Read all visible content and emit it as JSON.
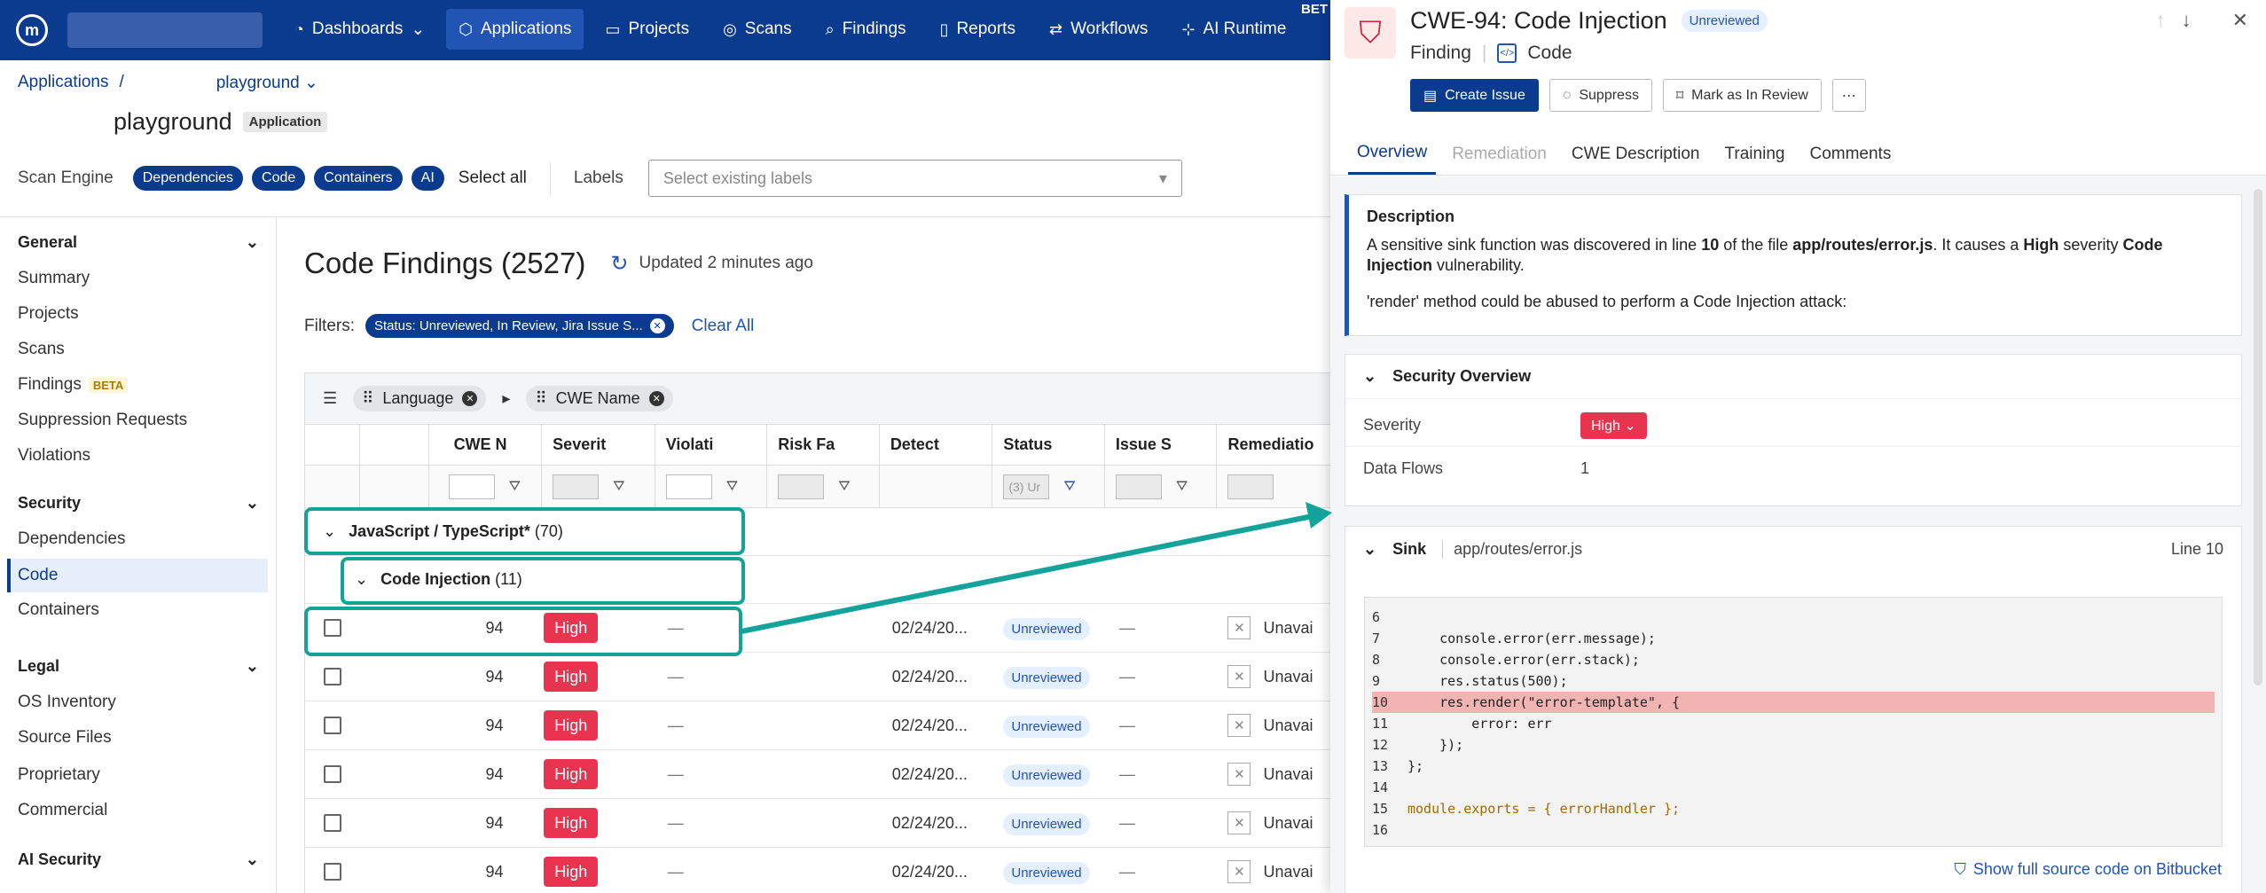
{
  "nav": {
    "items": [
      {
        "label": "Dashboards",
        "icon": "dashboard-icon"
      },
      {
        "label": "Applications",
        "icon": "applications-icon"
      },
      {
        "label": "Projects",
        "icon": "folder-icon"
      },
      {
        "label": "Scans",
        "icon": "scan-icon"
      },
      {
        "label": "Findings",
        "icon": "search-icon"
      },
      {
        "label": "Reports",
        "icon": "report-icon"
      },
      {
        "label": "Workflows",
        "icon": "workflow-icon"
      },
      {
        "label": "AI Runtime",
        "icon": "ai-icon"
      }
    ],
    "beta": "BET"
  },
  "breadcrumb": {
    "root": "Applications",
    "sep": "/",
    "app": "playground"
  },
  "app": {
    "title": "playground",
    "badge": "Application"
  },
  "engine": {
    "label": "Scan Engine",
    "pills": [
      "Dependencies",
      "Code",
      "Containers",
      "AI"
    ],
    "select_all": "Select all",
    "labels_label": "Labels",
    "labels_placeholder": "Select existing labels"
  },
  "sidebar": {
    "general": "General",
    "general_items": [
      "Summary",
      "Projects",
      "Scans",
      "Findings",
      "Suppression Requests",
      "Violations"
    ],
    "findings_beta": "BETA",
    "security": "Security",
    "security_items": [
      "Dependencies",
      "Code",
      "Containers"
    ],
    "legal": "Legal",
    "legal_items": [
      "OS Inventory",
      "Source Files",
      "Proprietary",
      "Commercial"
    ],
    "ai_security": "AI Security"
  },
  "main": {
    "title": "Code Findings (2527)",
    "updated": "Updated 2 minutes ago",
    "filters_label": "Filters:",
    "filter_chip": "Status: Unreviewed, In Review, Jira Issue S...",
    "clear_all": "Clear All",
    "group_chips": [
      "Language",
      "CWE Name"
    ],
    "columns": [
      "CWE N",
      "Severit",
      "Violati",
      "Risk Fa",
      "Detect",
      "Status",
      "Issue S",
      "Remediatio"
    ],
    "status_filter_placeholder": "(3) Ur",
    "group_lang": "JavaScript / TypeScript*",
    "group_lang_count": "(70)",
    "group_cwe": "Code Injection",
    "group_cwe_count": "(11)",
    "rows": [
      {
        "cwe": "94",
        "severity": "High",
        "violation": "—",
        "detected": "02/24/20...",
        "status": "Unreviewed",
        "issue": "—",
        "remediation": "Unavai"
      },
      {
        "cwe": "94",
        "severity": "High",
        "violation": "—",
        "detected": "02/24/20...",
        "status": "Unreviewed",
        "issue": "—",
        "remediation": "Unavai"
      },
      {
        "cwe": "94",
        "severity": "High",
        "violation": "—",
        "detected": "02/24/20...",
        "status": "Unreviewed",
        "issue": "—",
        "remediation": "Unavai"
      },
      {
        "cwe": "94",
        "severity": "High",
        "violation": "—",
        "detected": "02/24/20...",
        "status": "Unreviewed",
        "issue": "—",
        "remediation": "Unavai"
      },
      {
        "cwe": "94",
        "severity": "High",
        "violation": "—",
        "detected": "02/24/20...",
        "status": "Unreviewed",
        "issue": "—",
        "remediation": "Unavai"
      },
      {
        "cwe": "94",
        "severity": "High",
        "violation": "—",
        "detected": "02/24/20...",
        "status": "Unreviewed",
        "issue": "—",
        "remediation": "Unavai"
      }
    ]
  },
  "panel": {
    "title": "CWE-94: Code Injection",
    "status": "Unreviewed",
    "sub1": "Finding",
    "sub2": "Code",
    "actions": {
      "create": "Create Issue",
      "suppress": "Suppress",
      "review": "Mark as In Review",
      "more": "⋯"
    },
    "tabs": [
      "Overview",
      "Remediation",
      "CWE Description",
      "Training",
      "Comments"
    ],
    "desc": {
      "heading": "Description",
      "p1_a": "A sensitive sink function was discovered in line ",
      "p1_line": "10",
      "p1_b": " of the file ",
      "p1_file": "app/routes/error.js",
      "p1_c": ". It causes a ",
      "p1_sev": "High",
      "p1_d": " severity ",
      "p1_vuln1": "Code",
      "p1_vuln2": "Injection",
      "p1_e": " vulnerability.",
      "p2": "'render' method could be abused to perform a Code Injection attack:"
    },
    "security_overview": {
      "heading": "Security Overview",
      "severity_label": "Severity",
      "severity_value": "High",
      "flows_label": "Data Flows",
      "flows_value": "1"
    },
    "sink": {
      "label": "Sink",
      "file": "app/routes/error.js",
      "line": "Line 10"
    },
    "code": [
      {
        "n": "6",
        "t": ""
      },
      {
        "n": "7",
        "t": "    console.error(err.message);"
      },
      {
        "n": "8",
        "t": "    console.error(err.stack);"
      },
      {
        "n": "9",
        "t": "    res.status(500);"
      },
      {
        "n": "10",
        "t": "    res.render(\"error-template\", {"
      },
      {
        "n": "11",
        "t": "        error: err"
      },
      {
        "n": "12",
        "t": "    });"
      },
      {
        "n": "13",
        "t": "};"
      },
      {
        "n": "14",
        "t": ""
      },
      {
        "n": "15",
        "t": "module.exports = { errorHandler };"
      },
      {
        "n": "16",
        "t": ""
      }
    ],
    "bitbucket": "Show full source code on Bitbucket"
  },
  "colors": {
    "nav": "#0b3b8f",
    "accent": "#2254b4",
    "high": "#e8344e",
    "highlight": "#14a39a"
  }
}
